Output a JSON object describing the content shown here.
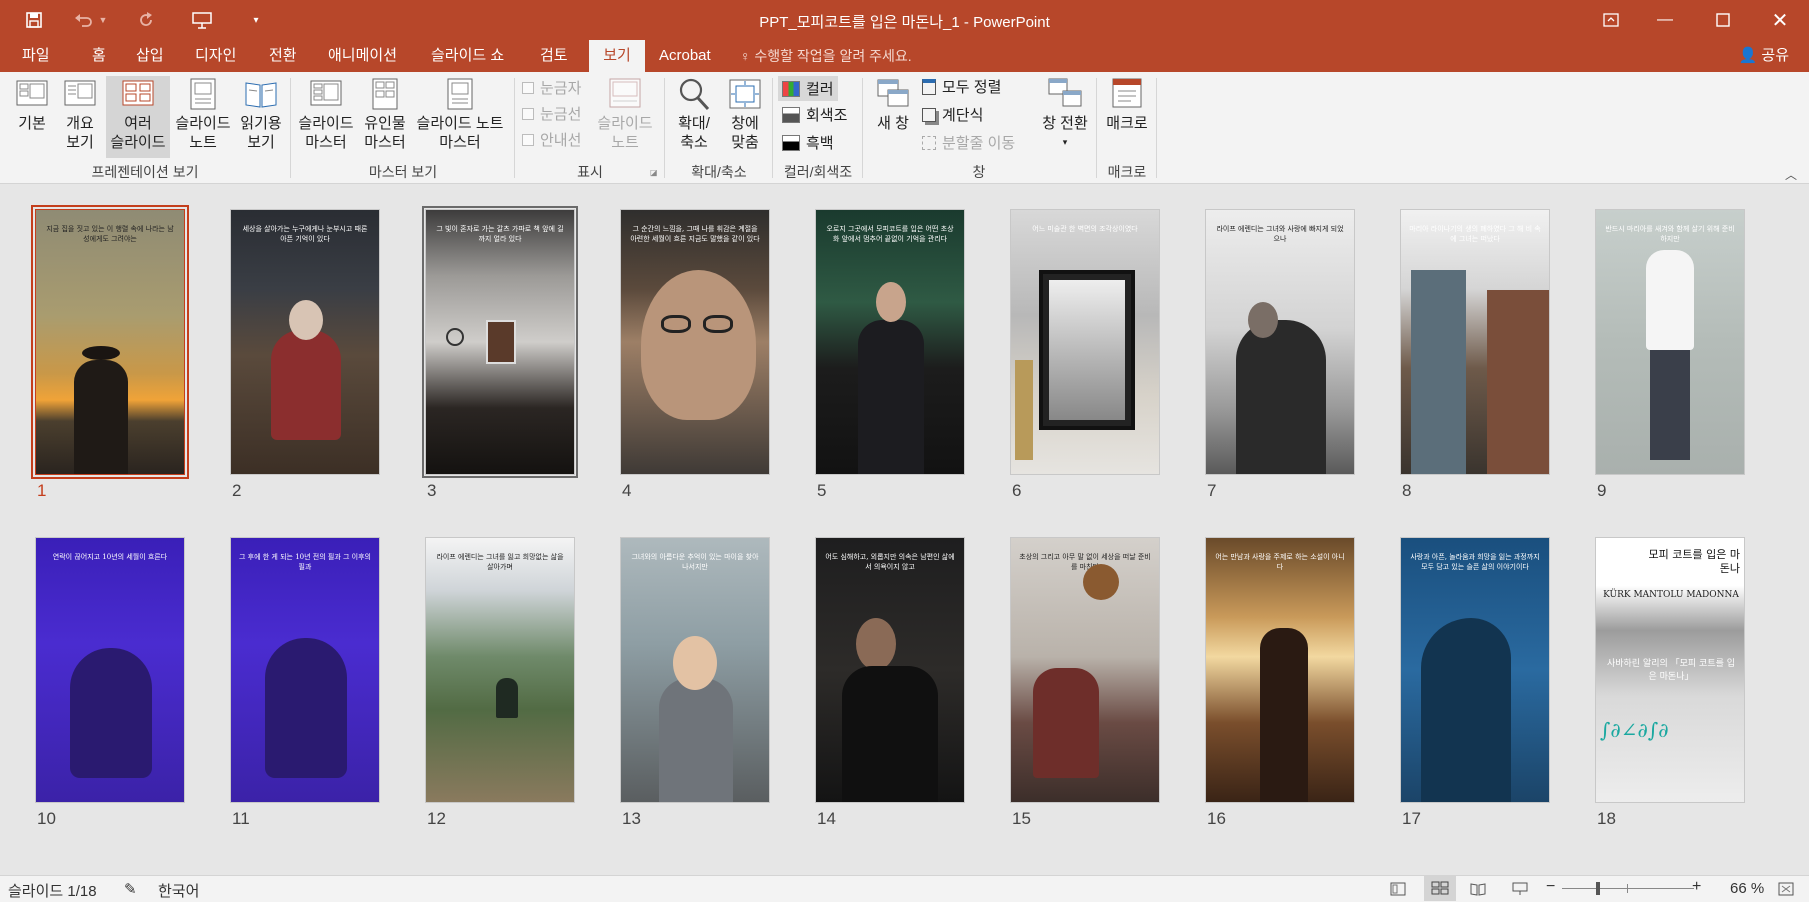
{
  "window": {
    "title": "PPT_모피코트를 입은 마돈나_1 - PowerPoint"
  },
  "tabs": [
    "파일",
    "홈",
    "삽입",
    "디자인",
    "전환",
    "애니메이션",
    "슬라이드 쇼",
    "검토",
    "보기",
    "Acrobat"
  ],
  "tell_me": "수행할 작업을 알려 주세요.",
  "share": "공유",
  "ribbon": {
    "presentation_views": {
      "normal": "기본",
      "outline": "개요",
      "outline2": "보기",
      "sorter": "여러",
      "sorter2": "슬라이드",
      "notes": "슬라이드",
      "notes2": "노트",
      "reading": "읽기용",
      "reading2": "보기",
      "label": "프레젠테이션 보기"
    },
    "master_views": {
      "slide_master": "슬라이드",
      "slide_master2": "마스터",
      "handout": "유인물",
      "handout2": "마스터",
      "notes_master": "슬라이드 노트",
      "notes_master2": "마스터",
      "label": "마스터 보기"
    },
    "show": {
      "ruler": "눈금자",
      "gridlines": "눈금선",
      "guides": "안내선",
      "notes": "슬라이드",
      "notes2": "노트",
      "label": "표시"
    },
    "zoom": {
      "zoom": "확대/",
      "zoom2": "축소",
      "fit": "창에",
      "fit2": "맞춤",
      "label": "확대/축소"
    },
    "color": {
      "color": "컬러",
      "gray": "회색조",
      "bw": "흑백",
      "label": "컬러/회색조"
    },
    "window": {
      "new": "새 창",
      "arrange": "모두 정렬",
      "cascade": "계단식",
      "split": "분할줄 이동",
      "label": "창"
    },
    "switch": {
      "switch": "창 전환"
    },
    "macros": {
      "macros": "매크로",
      "label": "매크로"
    }
  },
  "slides": [
    {
      "n": "1",
      "cap": "지금 집을 짓고 있는 이 행렬 속에 나라는 남성에게도 그려야는"
    },
    {
      "n": "2",
      "cap": "세상을 살아가는 누구에게나 눈부시고 때론 아픈 기억이 있다"
    },
    {
      "n": "3",
      "cap": "그 빛이 혼자로 가는 갈츠 가파로 책 앞에 길까지 얼라 있다"
    },
    {
      "n": "4",
      "cap": "그 순간의 느낌을, 그때 나를 휘감은 계절을 아련한 세월이 흐른 지금도 말했을 같이 있다"
    },
    {
      "n": "5",
      "cap": "오로지 그곳에서 모피코트를 입은 어떤 초상화 앞에서 멈추어 끝없이 기억을 관리다"
    },
    {
      "n": "6",
      "cap": "어느 미술관 한 벽면의 조각상이였다"
    },
    {
      "n": "7",
      "cap": "라이프 에렌디는 그녀와 사랑에 빠지게 되었으나"
    },
    {
      "n": "8",
      "cap": "마리아 라이나기의 생의 폐하였다 그 해 비 속에 그녀는 떠났다"
    },
    {
      "n": "9",
      "cap": "반드시 마리아를 새겨와 함께 살기 위해 준비하지만"
    },
    {
      "n": "10",
      "cap": "연락이 끊어지고 10년의 세월이 흐른다"
    },
    {
      "n": "11",
      "cap": "그 후에 한 게 되는 10년 전의 필과 그 이후의 필과"
    },
    {
      "n": "12",
      "cap": "라이프 에렌디는 그녀를 잃고 희망없는 삶을 살아가며"
    },
    {
      "n": "13",
      "cap": "그녀와의 아름다운 추억이 있는 마이을 찾아 나서지만"
    },
    {
      "n": "14",
      "cap": "어도 심해하고, 외롭지만 의속은 남편인 삶에서 의욕이지 않고"
    },
    {
      "n": "15",
      "cap": "초상의 그리고 아무 말 없이 세상을 떠날 준비를 마친다"
    },
    {
      "n": "16",
      "cap": "어는 만남과 사랑을 주제로 하는 소설이 아니다"
    },
    {
      "n": "17",
      "cap": "사랑과 아픈, 놀라움과 희망을 잃는 과정까지 모두 담고 있는 슬픈 삶의 이야기이다"
    },
    {
      "n": "18",
      "cap": "모피 코트를 입은 마돈나",
      "cap2": "KÜRK MANTOLU MADONNA",
      "cap3": "사바하린 알리의 「모피 코트를 입은 마돈나」"
    }
  ],
  "status": {
    "slide": "슬라이드 1/18",
    "lang": "한국어",
    "zoom": "66 %"
  }
}
